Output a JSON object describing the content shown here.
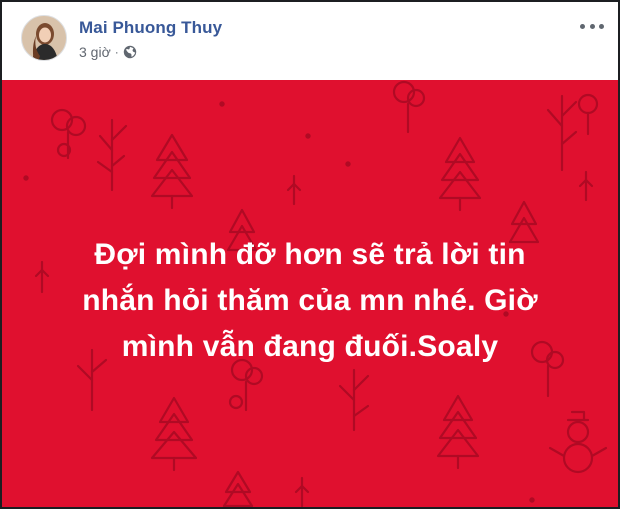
{
  "post": {
    "author": "Mai Phuong Thuy",
    "time": "3 giờ",
    "separator": "·",
    "privacy_icon": "globe-icon",
    "more_icon": "more-options-icon",
    "text_lines": [
      "Đợi mình đỡ hơn sẽ trả lời tin",
      "nhắn hỏi thăm của mn nhé. Giờ",
      "mình vẫn đang đuối.Soaly"
    ],
    "background_color": "#e0102f",
    "pattern_color": "#b00a24"
  }
}
